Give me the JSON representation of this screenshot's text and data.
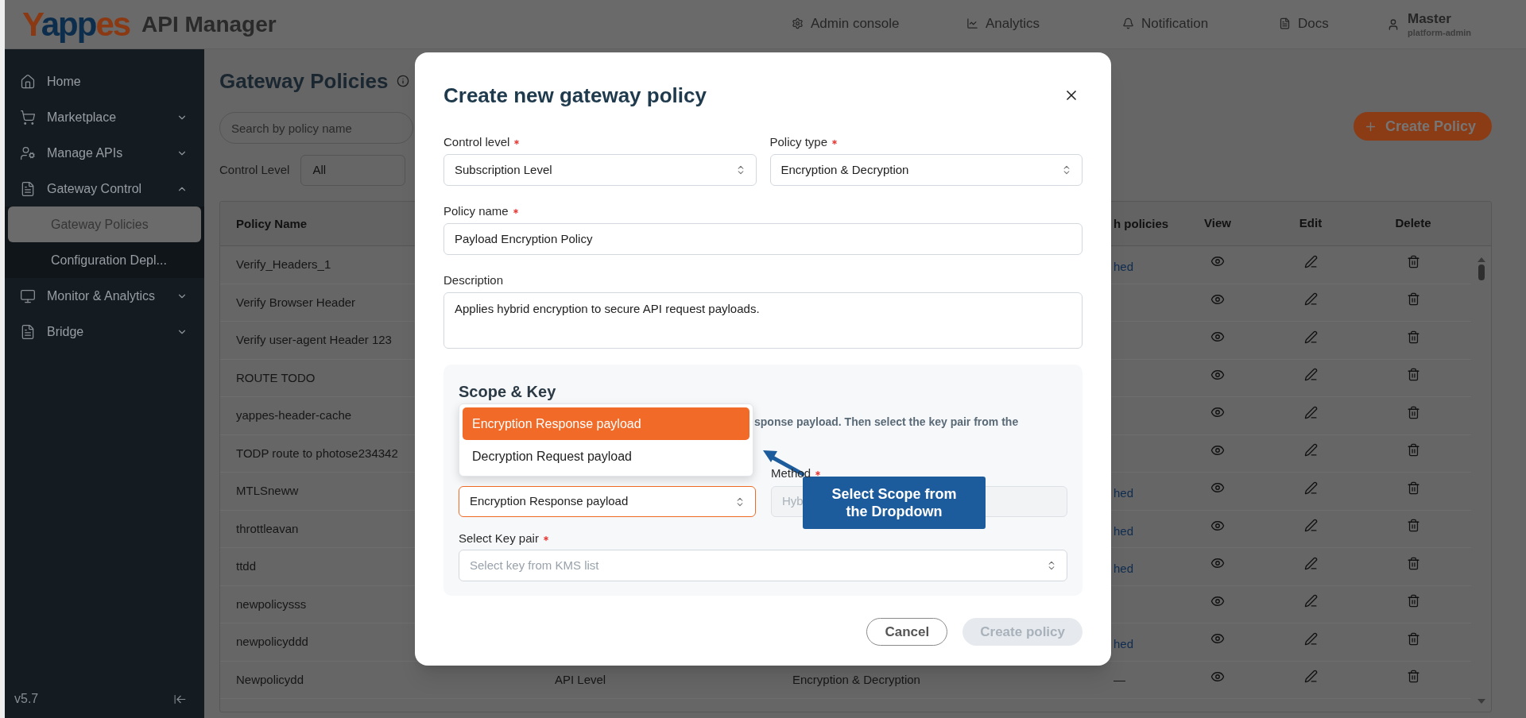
{
  "header": {
    "logo": "Yappes",
    "title": "API Manager",
    "nav": [
      "Admin console",
      "Analytics",
      "Notification",
      "Docs"
    ],
    "user": {
      "name": "Master",
      "role": "platform-admin"
    }
  },
  "sidebar": {
    "items": [
      {
        "label": "Home",
        "kind": "link"
      },
      {
        "label": "Marketplace",
        "kind": "group",
        "expanded": false
      },
      {
        "label": "Manage APIs",
        "kind": "group",
        "expanded": false
      },
      {
        "label": "Gateway Control",
        "kind": "group",
        "expanded": true,
        "children": [
          {
            "label": "Gateway Policies",
            "selected": true
          },
          {
            "label": "Configuration Depl...",
            "selected": false
          }
        ]
      },
      {
        "label": "Monitor & Analytics",
        "kind": "group",
        "expanded": false
      },
      {
        "label": "Bridge",
        "kind": "group",
        "expanded": false
      }
    ],
    "version": "v5.7"
  },
  "page": {
    "title": "Gateway Policies",
    "search": {
      "placeholder": "Search by policy name"
    },
    "filter": {
      "label": "Control Level",
      "value": "All"
    },
    "create_button": "Create Policy"
  },
  "table": {
    "columns": {
      "policy_name": "Policy Name",
      "column_4": "h policies",
      "view": "View",
      "edit": "Edit",
      "delete": "Delete"
    },
    "rows": [
      {
        "policy_name": "Verify_Headers_1",
        "column_4": {
          "text": "hed",
          "kind": "link"
        }
      },
      {
        "policy_name": "Verify Browser Header"
      },
      {
        "policy_name": "Verify user-agent Header 123"
      },
      {
        "policy_name": "ROUTE TODO"
      },
      {
        "policy_name": "yappes-header-cache"
      },
      {
        "policy_name": "TODP route to photose234342"
      },
      {
        "policy_name": "MTLSneww",
        "column_4": {
          "text": "hed",
          "kind": "link"
        }
      },
      {
        "policy_name": "throttleavan",
        "column_4": {
          "text": "hed",
          "kind": "link"
        }
      },
      {
        "policy_name": "ttdd",
        "column_4": {
          "text": "hed",
          "kind": "link"
        }
      },
      {
        "policy_name": "newpolicysss"
      },
      {
        "policy_name": "newpolicyddd",
        "column_4": {
          "text": "hed",
          "kind": "link"
        }
      },
      {
        "policy_name": "Newpolicydd",
        "column_2": "API Level",
        "column_3": "Encryption & Decryption",
        "column_4": {
          "text": "—",
          "kind": "text"
        }
      }
    ]
  },
  "dialog": {
    "title": "Create new gateway policy",
    "form_rows": [
      [
        {
          "label": "Control level",
          "required": true,
          "kind": "select",
          "value": "Subscription Level"
        },
        {
          "label": "Policy type",
          "required": true,
          "kind": "select",
          "value": "Encryption & Decryption"
        }
      ],
      [
        {
          "label": "Policy name",
          "required": true,
          "kind": "input",
          "value": "Payload Encryption Policy"
        }
      ],
      [
        {
          "label": "Description",
          "required": false,
          "kind": "textarea",
          "value": "Applies hybrid encryption to secure API request payloads."
        }
      ]
    ],
    "scope_section": {
      "title": "Scope & Key",
      "description": "sponse payload. Then select the key pair from the",
      "scope": {
        "value": "Encryption Response payload",
        "focused": true
      },
      "method": {
        "label": "Method",
        "required": true,
        "value": "Hyb",
        "disabled": true
      },
      "key_pair": {
        "label": "Select Key pair",
        "required": true,
        "placeholder": "Select key from KMS list"
      },
      "scope_menu": [
        {
          "label": "Encryption Response payload",
          "selected": true
        },
        {
          "label": "Decryption Request payload",
          "selected": false
        }
      ]
    },
    "buttons": [
      {
        "label": "Cancel",
        "kind": "secondary",
        "disabled": false
      },
      {
        "label": "Create policy",
        "kind": "primary",
        "disabled": true
      }
    ]
  },
  "callout": {
    "text": "Select Scope from the Dropdown"
  }
}
